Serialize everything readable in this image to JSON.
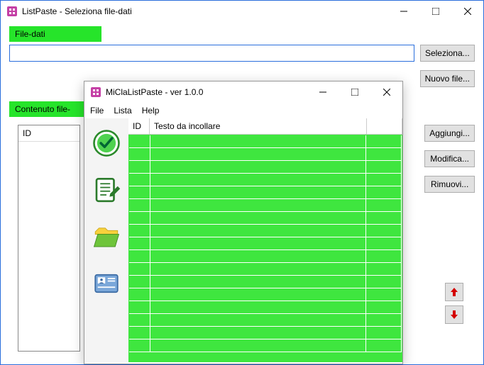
{
  "main": {
    "title": "ListPaste - Seleziona file-dati",
    "file_label": "File-dati",
    "file_value": "",
    "btn_seleziona": "Seleziona...",
    "btn_nuovo": "Nuovo file...",
    "content_label": "Contenuto file-",
    "list_header": "ID",
    "btn_aggiungi": "Aggiungi...",
    "btn_modifica": "Modifica...",
    "btn_rimuovi": "Rimuovi..."
  },
  "sec": {
    "title": "MiClaListPaste - ver 1.0.0",
    "menu": {
      "file": "File",
      "lista": "Lista",
      "help": "Help"
    },
    "col_id": "ID",
    "col_text": "Testo da incollare",
    "tools": {
      "check": "check-icon",
      "note": "note-edit-icon",
      "folder": "folder-open-icon",
      "contacts": "contacts-icon"
    },
    "rows": 17
  }
}
